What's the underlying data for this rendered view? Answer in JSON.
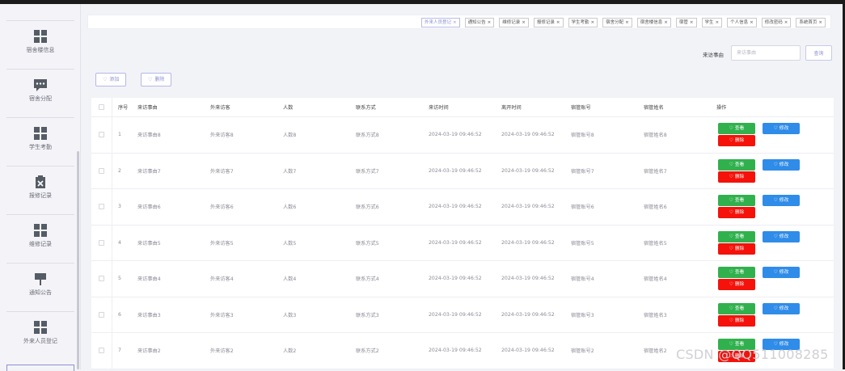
{
  "sidebar": {
    "items": [
      {
        "label": "宿舍楼信息",
        "icon": "grid-icon"
      },
      {
        "label": "宿舍分配",
        "icon": "message-icon"
      },
      {
        "label": "学生考勤",
        "icon": "grid-icon"
      },
      {
        "label": "报修记录",
        "icon": "clipboard-x-icon"
      },
      {
        "label": "维修记录",
        "icon": "grid-icon"
      },
      {
        "label": "通知公告",
        "icon": "pushpin-icon"
      },
      {
        "label": "外来人员登记",
        "icon": "grid-icon"
      }
    ]
  },
  "tabs": [
    {
      "label": "外来人员登记",
      "active": true
    },
    {
      "label": "通知公告",
      "active": false
    },
    {
      "label": "维修记录",
      "active": false
    },
    {
      "label": "报修记录",
      "active": false
    },
    {
      "label": "学生考勤",
      "active": false
    },
    {
      "label": "宿舍分配",
      "active": false
    },
    {
      "label": "宿舍楼信息",
      "active": false
    },
    {
      "label": "宿管",
      "active": false
    },
    {
      "label": "学生",
      "active": false
    },
    {
      "label": "个人信息",
      "active": false
    },
    {
      "label": "修改密码",
      "active": false
    },
    {
      "label": "系统首页",
      "active": false
    }
  ],
  "search": {
    "label": "来访事由",
    "placeholder": "来访事由",
    "button": "查询"
  },
  "toolbar": {
    "add": "添加",
    "delete": "删除"
  },
  "table": {
    "headers": [
      "序号",
      "来访事由",
      "外来访客",
      "人数",
      "联系方式",
      "来访时间",
      "离开时间",
      "宿管账号",
      "宿管姓名",
      "操作"
    ],
    "rows": [
      [
        "1",
        "来访事由8",
        "外来访客8",
        "人数8",
        "联系方式8",
        "2024-03-19 09:46:52",
        "2024-03-19 09:46:52",
        "宿管账号8",
        "宿管姓名8"
      ],
      [
        "2",
        "来访事由7",
        "外来访客7",
        "人数7",
        "联系方式7",
        "2024-03-19 09:46:52",
        "2024-03-19 09:46:52",
        "宿管账号7",
        "宿管姓名7"
      ],
      [
        "3",
        "来访事由6",
        "外来访客6",
        "人数6",
        "联系方式6",
        "2024-03-19 09:46:52",
        "2024-03-19 09:46:52",
        "宿管账号6",
        "宿管姓名6"
      ],
      [
        "4",
        "来访事由5",
        "外来访客5",
        "人数5",
        "联系方式5",
        "2024-03-19 09:46:52",
        "2024-03-19 09:46:52",
        "宿管账号5",
        "宿管姓名5"
      ],
      [
        "5",
        "来访事由4",
        "外来访客4",
        "人数4",
        "联系方式4",
        "2024-03-19 09:46:52",
        "2024-03-19 09:46:52",
        "宿管账号4",
        "宿管姓名4"
      ],
      [
        "6",
        "来访事由3",
        "外来访客3",
        "人数3",
        "联系方式3",
        "2024-03-19 09:46:52",
        "2024-03-19 09:46:52",
        "宿管账号3",
        "宿管姓名3"
      ],
      [
        "7",
        "来访事由2",
        "外来访客2",
        "人数2",
        "联系方式2",
        "2024-03-19 09:46:52",
        "2024-03-19 09:46:52",
        "宿管账号2",
        "宿管姓名2"
      ]
    ],
    "ops": {
      "view": "查看",
      "edit": "修改",
      "delete": "删除"
    }
  },
  "watermark": "CSDN @QQ511008285",
  "colors": {
    "accent": "#8a8fd6",
    "view": "#31b14e",
    "edit": "#2f8ce8",
    "delete": "#f4120a"
  }
}
